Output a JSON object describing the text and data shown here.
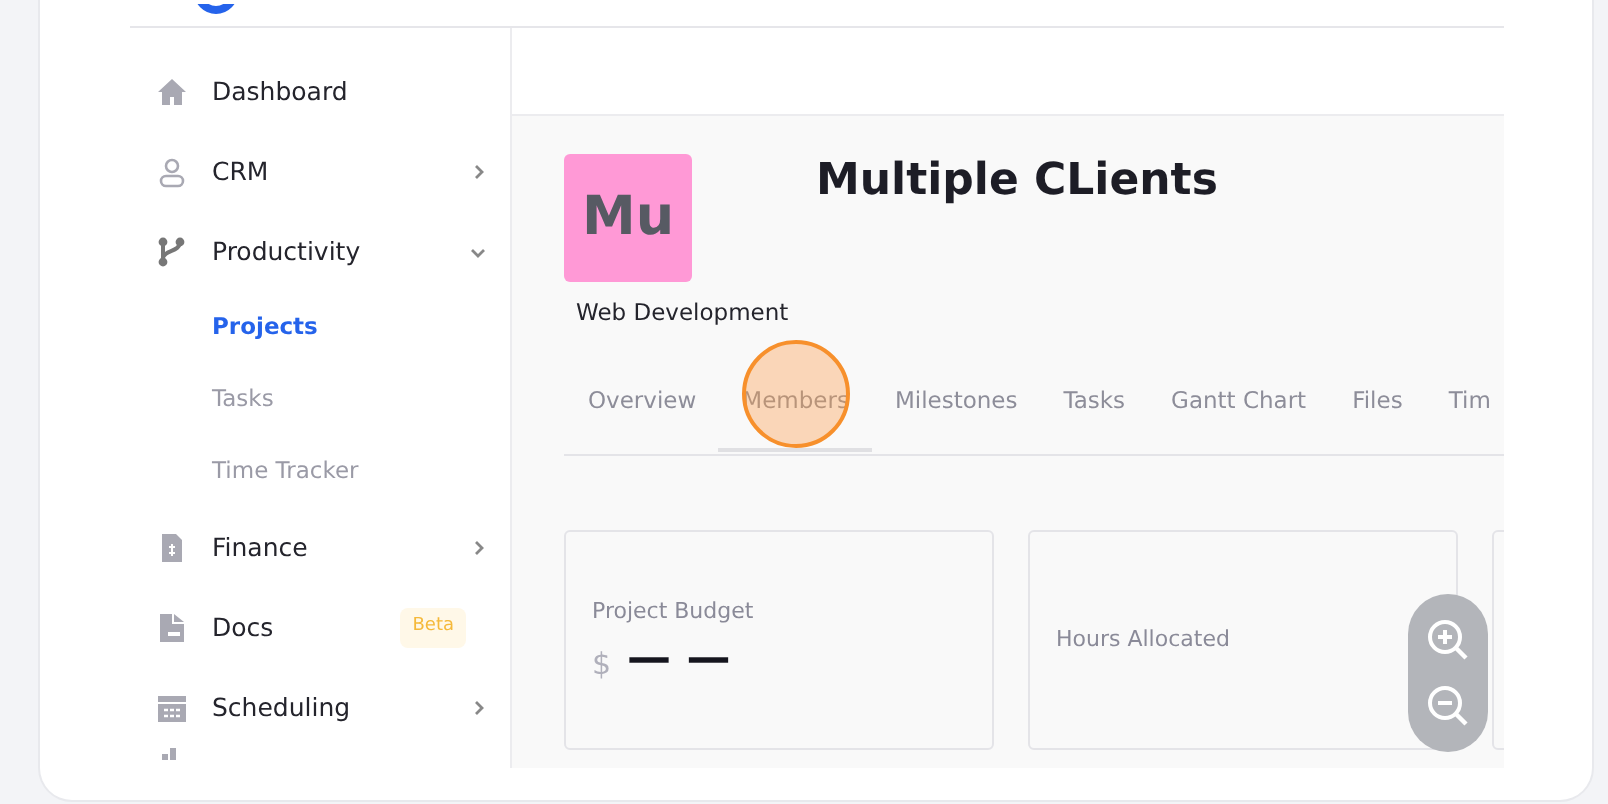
{
  "sidebar": {
    "items": [
      {
        "label": "Dashboard"
      },
      {
        "label": "CRM",
        "expanded": false
      },
      {
        "label": "Productivity",
        "expanded": true,
        "children": [
          {
            "label": "Projects",
            "selected": true
          },
          {
            "label": "Tasks",
            "selected": false
          },
          {
            "label": "Time Tracker",
            "selected": false
          }
        ]
      },
      {
        "label": "Finance",
        "expanded": false
      },
      {
        "label": "Docs",
        "badge": "Beta"
      },
      {
        "label": "Scheduling",
        "expanded": false
      }
    ]
  },
  "project": {
    "avatar": "Mu",
    "title": "Multiple CLients",
    "subtitle": "Web Development"
  },
  "tabs": [
    {
      "label": "Overview",
      "selected": false,
      "clicked": false
    },
    {
      "label": "Members",
      "selected": true,
      "clicked": true
    },
    {
      "label": "Milestones",
      "selected": false,
      "clicked": false
    },
    {
      "label": "Tasks",
      "selected": false,
      "clicked": false
    },
    {
      "label": "Gantt Chart",
      "selected": false,
      "clicked": false
    },
    {
      "label": "Files",
      "selected": false,
      "clicked": false
    },
    {
      "label": "Tim",
      "selected": false,
      "clicked": false
    }
  ],
  "stats": [
    {
      "kind": "value",
      "label": "Project Budget",
      "currency": "$",
      "value": "— —"
    },
    {
      "kind": "label",
      "label": "Hours Allocated"
    },
    {
      "kind": "empty"
    }
  ]
}
